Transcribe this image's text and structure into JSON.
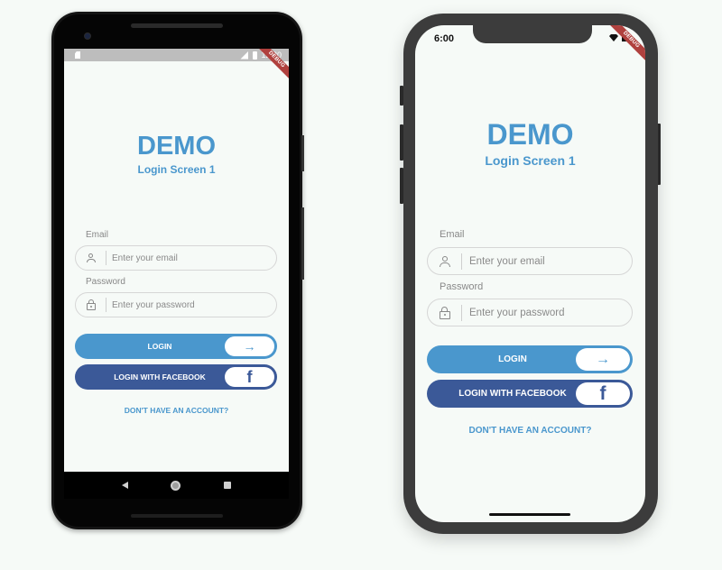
{
  "android": {
    "status_bar": {
      "time": "12:30",
      "icons": [
        "sim-card-icon",
        "signal-icon",
        "battery-icon"
      ]
    },
    "debug_banner": "DEBUG",
    "nav_bar": {
      "icons": [
        "back-icon",
        "home-icon",
        "recent-apps-icon"
      ]
    }
  },
  "iphone": {
    "status_bar": {
      "time": "6:00",
      "icons": [
        "wifi-icon",
        "battery-icon"
      ]
    },
    "debug_banner": "DEBUG"
  },
  "app": {
    "title": "DEMO",
    "subtitle": "Login Screen 1",
    "email": {
      "label": "Email",
      "placeholder": "Enter your email",
      "value": "",
      "icon": "user-icon"
    },
    "password": {
      "label": "Password",
      "placeholder": "Enter your password",
      "value": "",
      "icon": "lock-icon"
    },
    "login_button": {
      "label": "LOGIN",
      "icon": "arrow-right-icon",
      "icon_glyph": "→",
      "color": "#4a97cd"
    },
    "facebook_button": {
      "label": "LOGIN WITH FACEBOOK",
      "icon": "facebook-icon",
      "icon_glyph": "f",
      "color": "#3b5998"
    },
    "signup_link": "DON'T HAVE AN ACCOUNT?",
    "accent_color": "#4a97cd"
  }
}
